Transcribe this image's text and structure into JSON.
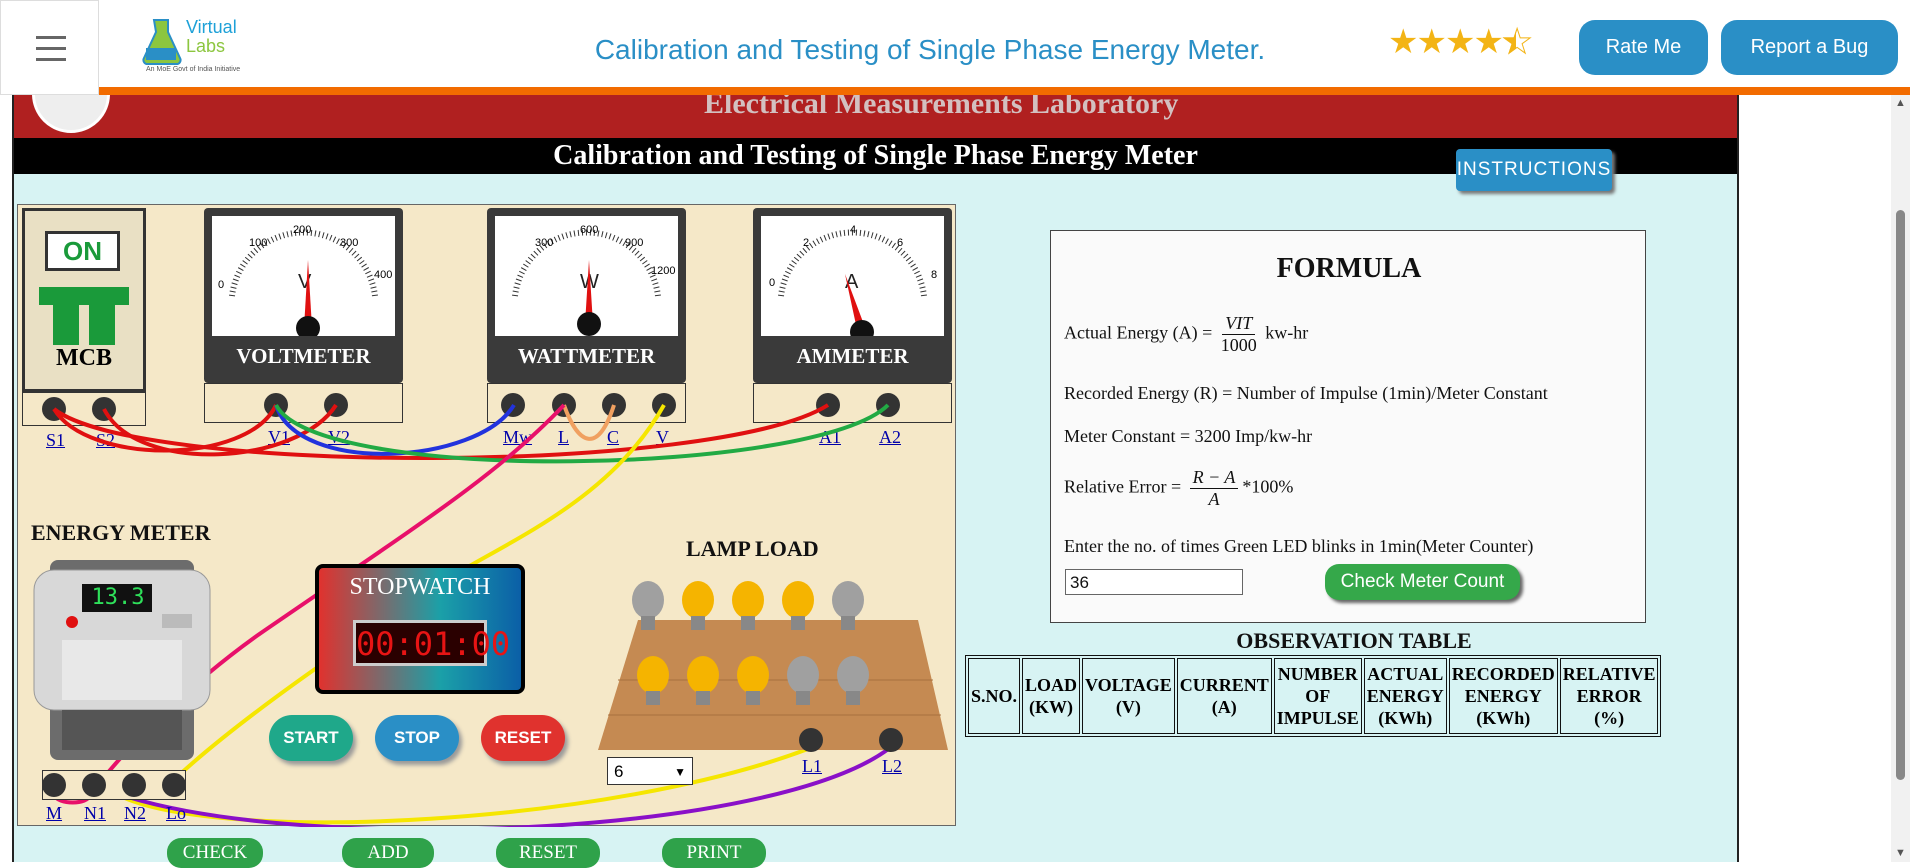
{
  "navbar": {
    "brand_top": "Virtual",
    "brand_bottom": "Labs",
    "brand_tagline": "An MoE Govt of India Initiative",
    "title": "Calibration and Testing of Single Phase Energy Meter.",
    "rating": 4.5,
    "rate_label": "Rate Me",
    "bug_label": "Report a Bug"
  },
  "header": {
    "lab_name": "Electrical Measurements Laboratory",
    "experiment_title": "Calibration and Testing of Single Phase Energy Meter"
  },
  "circuit": {
    "mcb": {
      "switch_label": "ON",
      "label": "MCB",
      "terminals": [
        "S1",
        "S2"
      ]
    },
    "voltmeter": {
      "label": "VOLTMETER",
      "unit": "V",
      "scale": [
        "0",
        "100",
        "200",
        "300",
        "400"
      ],
      "terminals": [
        "V1",
        "V2"
      ]
    },
    "wattmeter": {
      "label": "WATTMETER",
      "unit": "W",
      "scale": [
        "300",
        "600",
        "900",
        "1200"
      ],
      "terminals": [
        "Mw",
        "L",
        "C",
        "V"
      ]
    },
    "ammeter": {
      "label": "AMMETER",
      "unit": "A",
      "scale": [
        "0",
        "2",
        "4",
        "6",
        "8"
      ],
      "terminals": [
        "A1",
        "A2"
      ]
    },
    "energy_meter": {
      "label": "ENERGY METER",
      "display": "13.3",
      "terminals": [
        "M",
        "N1",
        "N2",
        "Lo"
      ]
    },
    "stopwatch": {
      "label": "STOPWATCH",
      "time": "00:01:00",
      "start": "START",
      "stop": "STOP",
      "reset": "RESET"
    },
    "lamp_load": {
      "label": "LAMP LOAD",
      "selected_count": "6",
      "terminals": [
        "L1",
        "L2"
      ]
    }
  },
  "bottom_buttons": [
    "CHECK",
    "ADD",
    "RESET",
    "PRINT"
  ],
  "instructions_label": "INSTRUCTIONS",
  "formula": {
    "title": "FORMULA",
    "actual_prefix": "Actual Energy (A) =",
    "actual_num": "VIT",
    "actual_den": "1000",
    "actual_suffix": "kw-hr",
    "recorded": "Recorded Energy (R) = Number of Impulse (1min)/Meter Constant",
    "meter_constant": "Meter Constant = 3200 Imp/kw-hr",
    "relative_prefix": "Relative Error =",
    "relative_num": "R − A",
    "relative_den": "A",
    "relative_suffix": "*100%",
    "prompt": "Enter the no. of times Green LED blinks in 1min(Meter Counter)",
    "count_value": "36",
    "check_label": "Check Meter Count"
  },
  "observation": {
    "title": "OBSERVATION TABLE",
    "headers": [
      [
        "S.NO."
      ],
      [
        "LOAD",
        "(KW)"
      ],
      [
        "VOLTAGE",
        "(V)"
      ],
      [
        "CURRENT",
        "(A)"
      ],
      [
        "NUMBER",
        "OF",
        "IMPULSE"
      ],
      [
        "ACTUAL",
        "ENERGY",
        "(KWh)"
      ],
      [
        "RECORDED",
        "ENERGY",
        "(KWh)"
      ],
      [
        "RELATIVE",
        "ERROR",
        "(%)"
      ]
    ]
  },
  "colors": {
    "accent": "#2a8fc6",
    "orange": "#f26b00",
    "header_red": "#b02020",
    "panel": "#d7f3f3"
  }
}
